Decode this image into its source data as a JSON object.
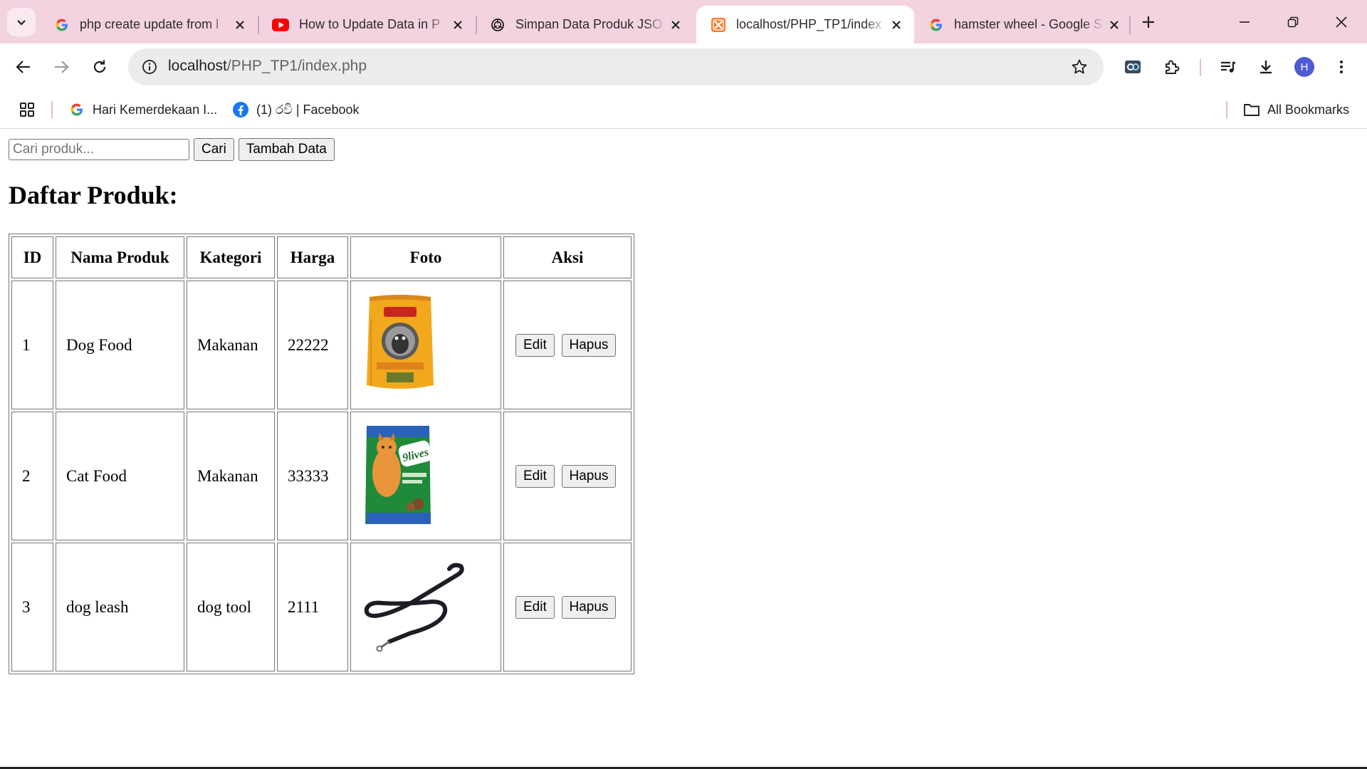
{
  "tabs": [
    {
      "title": "php create update from l",
      "icon": "google-icon",
      "active": false
    },
    {
      "title": "How to Update Data in P",
      "icon": "youtube-icon",
      "active": false
    },
    {
      "title": "Simpan Data Produk JSO",
      "icon": "chatgpt-icon",
      "active": false
    },
    {
      "title": "localhost/PHP_TP1/index",
      "icon": "xampp-icon",
      "active": true
    },
    {
      "title": "hamster wheel - Google S",
      "icon": "google-icon",
      "active": false
    }
  ],
  "address_bar": {
    "host": "localhost",
    "path": "/PHP_TP1/index.php"
  },
  "profile_initial": "H",
  "bookmarks": [
    {
      "label": "Hari Kemerdekaan I...",
      "icon": "google-icon"
    },
    {
      "label": "(1) රවි | Facebook",
      "icon": "facebook-icon"
    }
  ],
  "all_bookmarks_label": "All Bookmarks",
  "search": {
    "placeholder": "Cari produk...",
    "button_label": "Cari",
    "add_button_label": "Tambah Data"
  },
  "page_title": "Daftar Produk:",
  "table": {
    "headers": [
      "ID",
      "Nama Produk",
      "Kategori",
      "Harga",
      "Foto",
      "Aksi"
    ],
    "rows": [
      {
        "id": "1",
        "name": "Dog Food",
        "category": "Makanan",
        "price": "22222",
        "photo": "dog-food-bag-image"
      },
      {
        "id": "2",
        "name": "Cat Food",
        "category": "Makanan",
        "price": "33333",
        "photo": "cat-food-bag-image"
      },
      {
        "id": "3",
        "name": "dog leash",
        "category": "dog tool",
        "price": "2111",
        "photo": "dog-leash-image"
      }
    ],
    "edit_label": "Edit",
    "delete_label": "Hapus"
  },
  "cat_food_brand_text": "9lives",
  "colors": {
    "tabstrip": "#f4d3e1",
    "omnibox": "#ececec",
    "avatar": "#4f5bd5"
  }
}
